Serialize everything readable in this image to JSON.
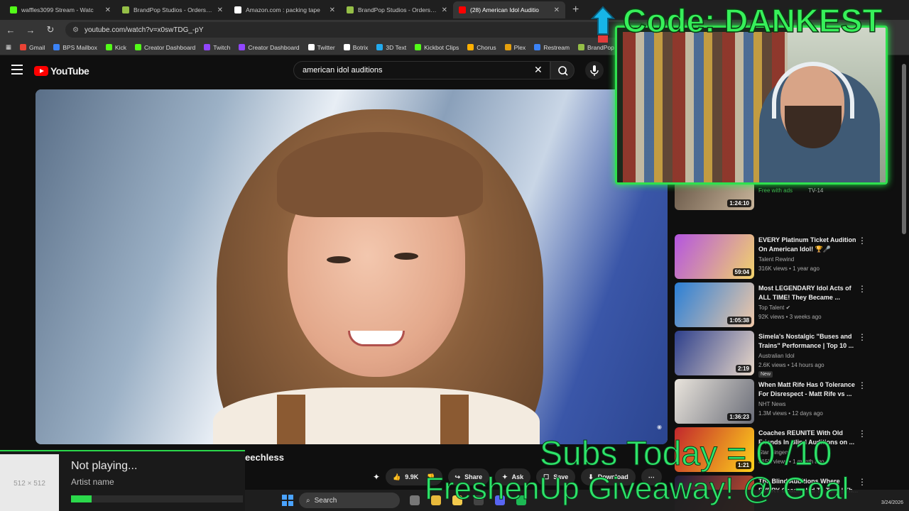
{
  "browser": {
    "tabs": [
      {
        "title": "waffles3099 Stream - Watc",
        "color": "#53fc18"
      },
      {
        "title": "BrandPop Studios - Orders - #1",
        "color": "#95bf47"
      },
      {
        "title": "Amazon.com : packing tape",
        "color": "#ffffff"
      },
      {
        "title": "BrandPop Studios - Orders - #1",
        "color": "#95bf47"
      },
      {
        "title": "(28) American Idol Auditio",
        "color": "#ff0000"
      }
    ],
    "url": "youtube.com/watch?v=x0swTDG_-pY",
    "bookmarks": [
      {
        "label": "Gmail",
        "color": "#ea4335"
      },
      {
        "label": "BPS Mailbox",
        "color": "#3b82f6"
      },
      {
        "label": "Kick",
        "color": "#53fc18"
      },
      {
        "label": "Creator Dashboard",
        "color": "#53fc18"
      },
      {
        "label": "Twitch",
        "color": "#9146ff"
      },
      {
        "label": "Creator Dashboard",
        "color": "#9146ff"
      },
      {
        "label": "Twitter",
        "color": "#ffffff"
      },
      {
        "label": "Botrix",
        "color": "#ffffff"
      },
      {
        "label": "3D Text",
        "color": "#22aaee"
      },
      {
        "label": "Kickbot Clips",
        "color": "#53fc18"
      },
      {
        "label": "Chorus",
        "color": "#ffb000"
      },
      {
        "label": "Plex",
        "color": "#e5a00d"
      },
      {
        "label": "Restream",
        "color": "#3b82f6"
      },
      {
        "label": "BrandPop",
        "color": "#95bf47"
      }
    ]
  },
  "youtube": {
    "logo": "YouTube",
    "search_value": "american idol auditions",
    "video_title_partial": "eechless",
    "actions": {
      "likes": "9.9K",
      "share": "Share",
      "ask": "Ask",
      "save": "Save",
      "download": "Download"
    }
  },
  "related": [
    {
      "title": "",
      "channel": "",
      "meta": "",
      "duration": "1:24:10",
      "free": "Free with ads",
      "rating": "TV-14",
      "thumb": [
        "#6b5a4a",
        "#c8b49a"
      ]
    },
    {
      "title": "EVERY Platinum Ticket Audition On American Idol! 🏆🎤",
      "channel": "Talent Rewind",
      "meta": "316K views • 1 year ago",
      "duration": "59:04",
      "thumb": [
        "#b455e0",
        "#f2d36b"
      ]
    },
    {
      "title": "Most LEGENDARY Idol Acts of ALL TIME! They Became ...",
      "channel": "Top Talent ✔",
      "meta": "92K views • 3 weeks ago",
      "duration": "1:05:38",
      "thumb": [
        "#2a7fd6",
        "#f1c8a8"
      ]
    },
    {
      "title": "Simela's Nostalgic \"Buses and Trains\" Performance | Top 10 ...",
      "channel": "Australian Idol",
      "meta": "2.6K views • 14 hours ago",
      "duration": "2:19",
      "badge": "New",
      "thumb": [
        "#2d3f8c",
        "#e9d8c8"
      ]
    },
    {
      "title": "When Matt Rife Has 0 Tolerance For Disrespect - Matt Rife vs ...",
      "channel": "NHT News",
      "meta": "1.3M views • 12 days ago",
      "duration": "1:36:23",
      "thumb": [
        "#e9e4dc",
        "#6a6d78"
      ]
    },
    {
      "title": "Coaches REUNITE With Old Friends In Blind Auditions on ...",
      "channel": "Star Singers",
      "meta": "815K views • 1 month ago",
      "duration": "1:21",
      "thumb": [
        "#c2272d",
        "#ffd21a"
      ]
    },
    {
      "title": "The Blind Auditions Where EVERY Coach Had To Turn | Th...",
      "channel": "",
      "meta": "",
      "duration": "",
      "thumb": [
        "#1c1c3a",
        "#d94f2a"
      ]
    }
  ],
  "overlay": {
    "code_text": "Code: DANKEST",
    "subs_text": "Subs Today = 0   /10",
    "giveaway_text": "FreshenUp Giveaway! @ Goal",
    "now_playing": {
      "status": "Not playing...",
      "artist": "Artist name",
      "art_label": "512 × 512",
      "progress": 0.12
    }
  },
  "taskbar": {
    "search": "Search",
    "date": "3/24/2026"
  }
}
